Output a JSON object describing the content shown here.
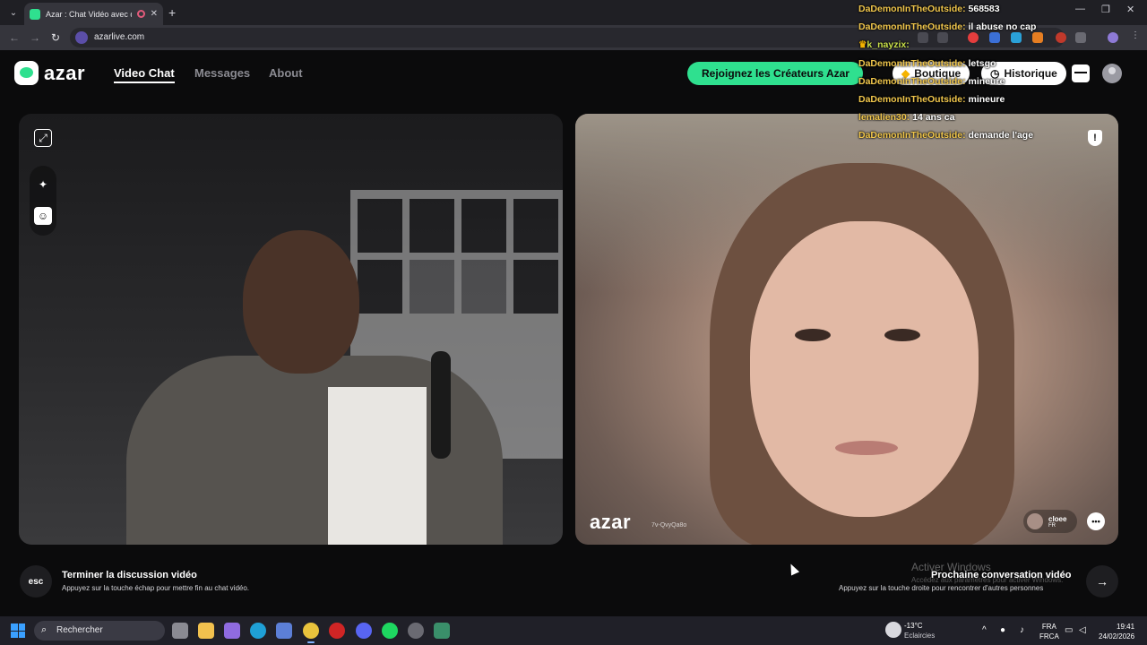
{
  "browser": {
    "tab_title": "Azar : Chat Vidéo avec de n",
    "url": "azarlive.com"
  },
  "header": {
    "logo": "azar",
    "nav": [
      {
        "label": "Video Chat",
        "active": true
      },
      {
        "label": "Messages",
        "active": false
      },
      {
        "label": "About",
        "active": false
      }
    ],
    "creators_button": "Rejoignez les Créateurs Azar",
    "shop_button": "Boutique",
    "history_button": "Historique"
  },
  "remote_video": {
    "watermark": "azar",
    "code": "7v-QvyQa8o",
    "partner_name": "cloee",
    "partner_country": "FR"
  },
  "bottom": {
    "esc_label": "esc",
    "end_title": "Terminer la discussion vidéo",
    "end_sub": "Appuyez sur la touche échap pour mettre fin au chat vidéo.",
    "next_title": "Prochaine conversation vidéo",
    "next_sub": "Appuyez sur la touche droite pour rencontrer d'autres personnes",
    "activate_title": "Activer Windows",
    "activate_sub": "Accédez aux paramètres pour activer Windows."
  },
  "chat": [
    {
      "user": "DaDemonInTheOutside:",
      "msg": "568583"
    },
    {
      "user": "DaDemonInTheOutside:",
      "msg": "il abuse no cap"
    },
    {
      "user": "k_nayzix:",
      "msg": ""
    },
    {
      "user": "DaDemonInTheOutside:",
      "msg": "letsgo"
    },
    {
      "user": "DaDemonInTheOutside:",
      "msg": "mineure"
    },
    {
      "user": "DaDemonInTheOutside:",
      "msg": "mineure"
    },
    {
      "user": "lemalien30:",
      "msg": "14 ans ca"
    },
    {
      "user": "DaDemonInTheOutside:",
      "msg": "demande l'age"
    }
  ],
  "taskbar": {
    "search_placeholder": "Rechercher",
    "weather_temp": "-13°C",
    "weather_desc": "Eclaircies",
    "lang_line1": "FRA",
    "lang_line2": "FRCA",
    "time": "19:41",
    "date": "24/02/2026"
  },
  "colors": {
    "accent": "#2fe08f",
    "chat_user": "#f0c64c"
  }
}
